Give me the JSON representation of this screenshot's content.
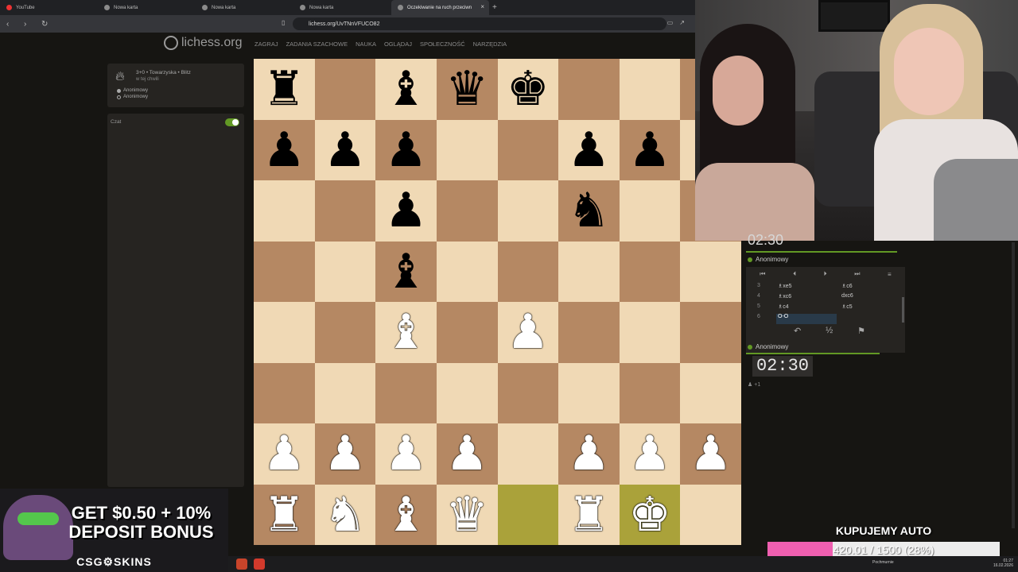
{
  "browser": {
    "tabs": [
      {
        "label": "YouTube",
        "active": false
      },
      {
        "label": "Nowa karta",
        "active": false
      },
      {
        "label": "Nowa karta",
        "active": false
      },
      {
        "label": "Nowa karta",
        "active": false
      },
      {
        "label": "Oczekiwanie na ruch przeciwn",
        "active": true
      }
    ],
    "url": "lichess.org/UvTNnVFUCO82",
    "newtab": "+",
    "close": "×"
  },
  "site": {
    "logo": "lichess.org",
    "menu": [
      "ZAGRAJ",
      "ZADANIA SZACHOWE",
      "NAUKA",
      "OGLĄDAJ",
      "SPOŁECZNOŚĆ",
      "NARZĘDZIA"
    ]
  },
  "game": {
    "title": "3+0 • Towarzyska • Blitz",
    "subtitle": "w tej chwili",
    "players": [
      "Anonimowy",
      "Anonimowy"
    ],
    "chat_label": "Czat"
  },
  "board": {
    "rows": [
      [
        "bR",
        "",
        "bB",
        "bQ",
        "bK",
        "",
        "",
        ""
      ],
      [
        "bP",
        "bP",
        "bP",
        "",
        "",
        "bP",
        "bP",
        ""
      ],
      [
        "",
        "",
        "bP",
        "",
        "",
        "bN",
        "",
        ""
      ],
      [
        "",
        "",
        "bB",
        "",
        "",
        "",
        "",
        ""
      ],
      [
        "",
        "",
        "wB",
        "",
        "wP",
        "",
        "",
        ""
      ],
      [
        "",
        "",
        "",
        "",
        "",
        "",
        "",
        ""
      ],
      [
        "wP",
        "wP",
        "wP",
        "wP",
        "",
        "wP",
        "wP",
        "wP"
      ],
      [
        "wR",
        "wN",
        "wB",
        "wQ",
        "",
        "wR",
        "wK",
        ""
      ]
    ],
    "highlights": [
      [
        7,
        4
      ],
      [
        7,
        6
      ]
    ]
  },
  "panel": {
    "top_clock": "02:30",
    "top_player": "Anonimowy",
    "controls": [
      "⏮",
      "⏴",
      "⏵",
      "⏭",
      "≡"
    ],
    "moves": [
      {
        "n": "3",
        "w": "♗xe5",
        "b": "♗c6"
      },
      {
        "n": "4",
        "w": "♗xc6",
        "b": "dxc6"
      },
      {
        "n": "5",
        "w": "♗c4",
        "b": "♗c5"
      },
      {
        "n": "6",
        "w": "O-O",
        "b": ""
      }
    ],
    "actions": [
      "↶",
      "½",
      "⚑"
    ],
    "bottom_player": "Anonimowy",
    "bottom_clock": "02:30",
    "plus": "+1"
  },
  "ad": {
    "line1": "GET $0.50 + 10%",
    "line2": "DEPOSIT BONUS",
    "brand": "CSG⚙SKINS"
  },
  "goal": {
    "title": "KUPUJEMY AUTO",
    "text": "420.01 / 1500 (28%)",
    "progress": 0.28
  },
  "taskbar": {
    "weather": "Pochmurnie",
    "time": "01:27",
    "date": "16.02.2026"
  }
}
